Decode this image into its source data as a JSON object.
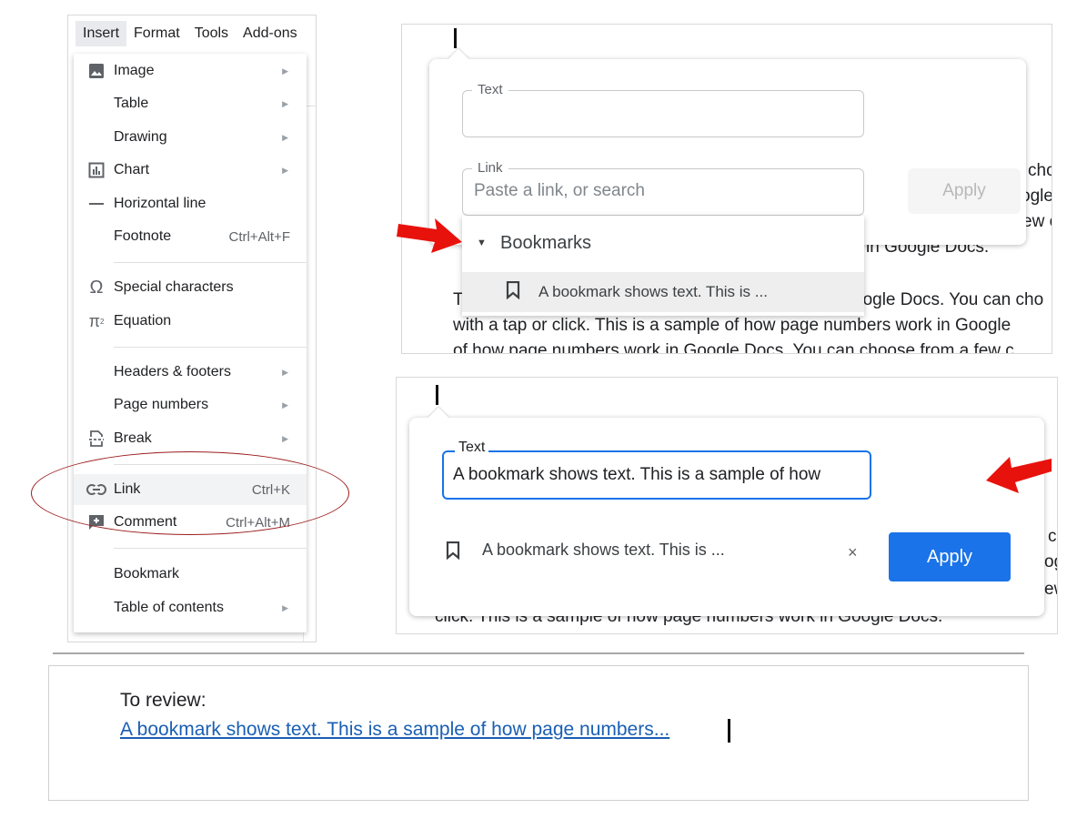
{
  "menubar": {
    "items": [
      "Insert",
      "Format",
      "Tools",
      "Add-ons"
    ]
  },
  "insert_menu": {
    "items": [
      {
        "label": "Image",
        "icon": "image-icon",
        "submenu": true
      },
      {
        "label": "Table",
        "submenu": true
      },
      {
        "label": "Drawing",
        "submenu": true
      },
      {
        "label": "Chart",
        "icon": "chart-icon",
        "submenu": true
      },
      {
        "label": "Horizontal line",
        "icon": "horizontal-line-icon"
      },
      {
        "label": "Footnote",
        "shortcut": "Ctrl+Alt+F"
      },
      {
        "label": "Special characters",
        "icon": "omega-icon"
      },
      {
        "label": "Equation",
        "icon": "pi-icon"
      },
      {
        "label": "Headers & footers",
        "submenu": true
      },
      {
        "label": "Page numbers",
        "submenu": true
      },
      {
        "label": "Break",
        "icon": "page-break-icon",
        "submenu": true
      },
      {
        "label": "Link",
        "icon": "link-icon",
        "shortcut": "Ctrl+K",
        "highlighted": true
      },
      {
        "label": "Comment",
        "icon": "comment-add-icon",
        "shortcut": "Ctrl+Alt+M"
      },
      {
        "label": "Bookmark"
      },
      {
        "label": "Table of contents",
        "submenu": true
      }
    ]
  },
  "link_dialog": {
    "text_label": "Text",
    "text_value": "",
    "link_label": "Link",
    "link_placeholder": "Paste a link, or search",
    "apply_label": "Apply",
    "bookmarks_header": "Bookmarks",
    "bookmark_item": "A bookmark shows text. This is ..."
  },
  "background_doc": {
    "line_end_1": "cho",
    "line_end_2": "ogle",
    "line_end_3": "ew c",
    "line_a": "in Google Docs.",
    "line_b_start": "T",
    "line_b_end": "oogle Docs. You can cho",
    "line_c": "with a tap or click. This is a sample of how page numbers work in Google",
    "line_d": "of how page numbers work in Google Docs. You can choose from a few c"
  },
  "edit_dialog": {
    "text_label": "Text",
    "text_value": "A bookmark shows text. This is a sample of how",
    "bookmark_chip": "A bookmark shows text. This is ...",
    "remove_symbol": "×",
    "apply_label": "Apply"
  },
  "background_doc2": {
    "line_end_1": "c",
    "line_end_2": "og",
    "line_end_3": "ew",
    "line_bottom": "click. This is a sample of how page numbers work in Google Docs."
  },
  "review": {
    "heading": "To review:",
    "link_text": "A bookmark shows text. This is a sample of how page numbers..."
  },
  "colors": {
    "accent": "#1a73e8",
    "link": "#1a5fb4",
    "arrow": "#e8120c",
    "oval": "#9b1c1c"
  }
}
